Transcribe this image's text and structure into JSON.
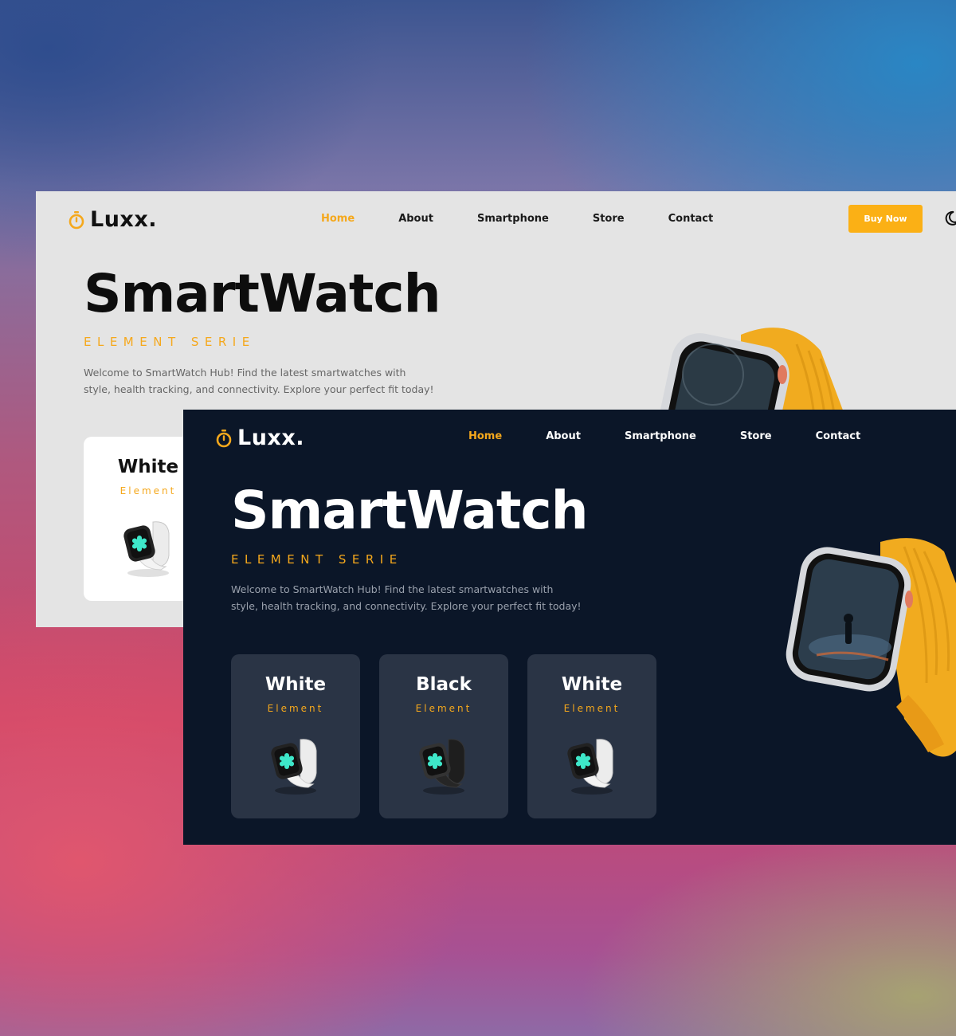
{
  "light": {
    "brand": "Luxx.",
    "nav": [
      "Home",
      "About",
      "Smartphone",
      "Store",
      "Contact"
    ],
    "buy_label": "Buy Now",
    "hero": {
      "title": "SmartWatch",
      "subtitle": "ELEMENT SERIE",
      "description": "Welcome to SmartWatch Hub! Find the latest smartwatches with style, health tracking, and connectivity. Explore your perfect fit today!"
    },
    "cards": [
      {
        "title": "White",
        "subtitle": "Element",
        "band": "white"
      }
    ]
  },
  "dark": {
    "brand": "Luxx.",
    "nav": [
      "Home",
      "About",
      "Smartphone",
      "Store",
      "Contact"
    ],
    "hero": {
      "title": "SmartWatch",
      "subtitle": "ELEMENT SERIE",
      "description": "Welcome to SmartWatch Hub! Find the latest smartwatches with style, health tracking, and connectivity. Explore your perfect fit today!"
    },
    "cards": [
      {
        "title": "White",
        "subtitle": "Element",
        "band": "white"
      },
      {
        "title": "Black",
        "subtitle": "Element",
        "band": "black"
      },
      {
        "title": "White",
        "subtitle": "Element",
        "band": "white"
      }
    ]
  },
  "icons": {
    "logo": "stopwatch-icon",
    "theme_toggle": "moon-icon",
    "product": "smartwatch-icon"
  },
  "colors": {
    "accent": "#f5a81c",
    "button": "#fbb015",
    "light_bg": "#e4e4e4",
    "dark_bg": "#0b1628",
    "dark_card": "#2a3445",
    "watch_band": "#f1ab1f"
  }
}
